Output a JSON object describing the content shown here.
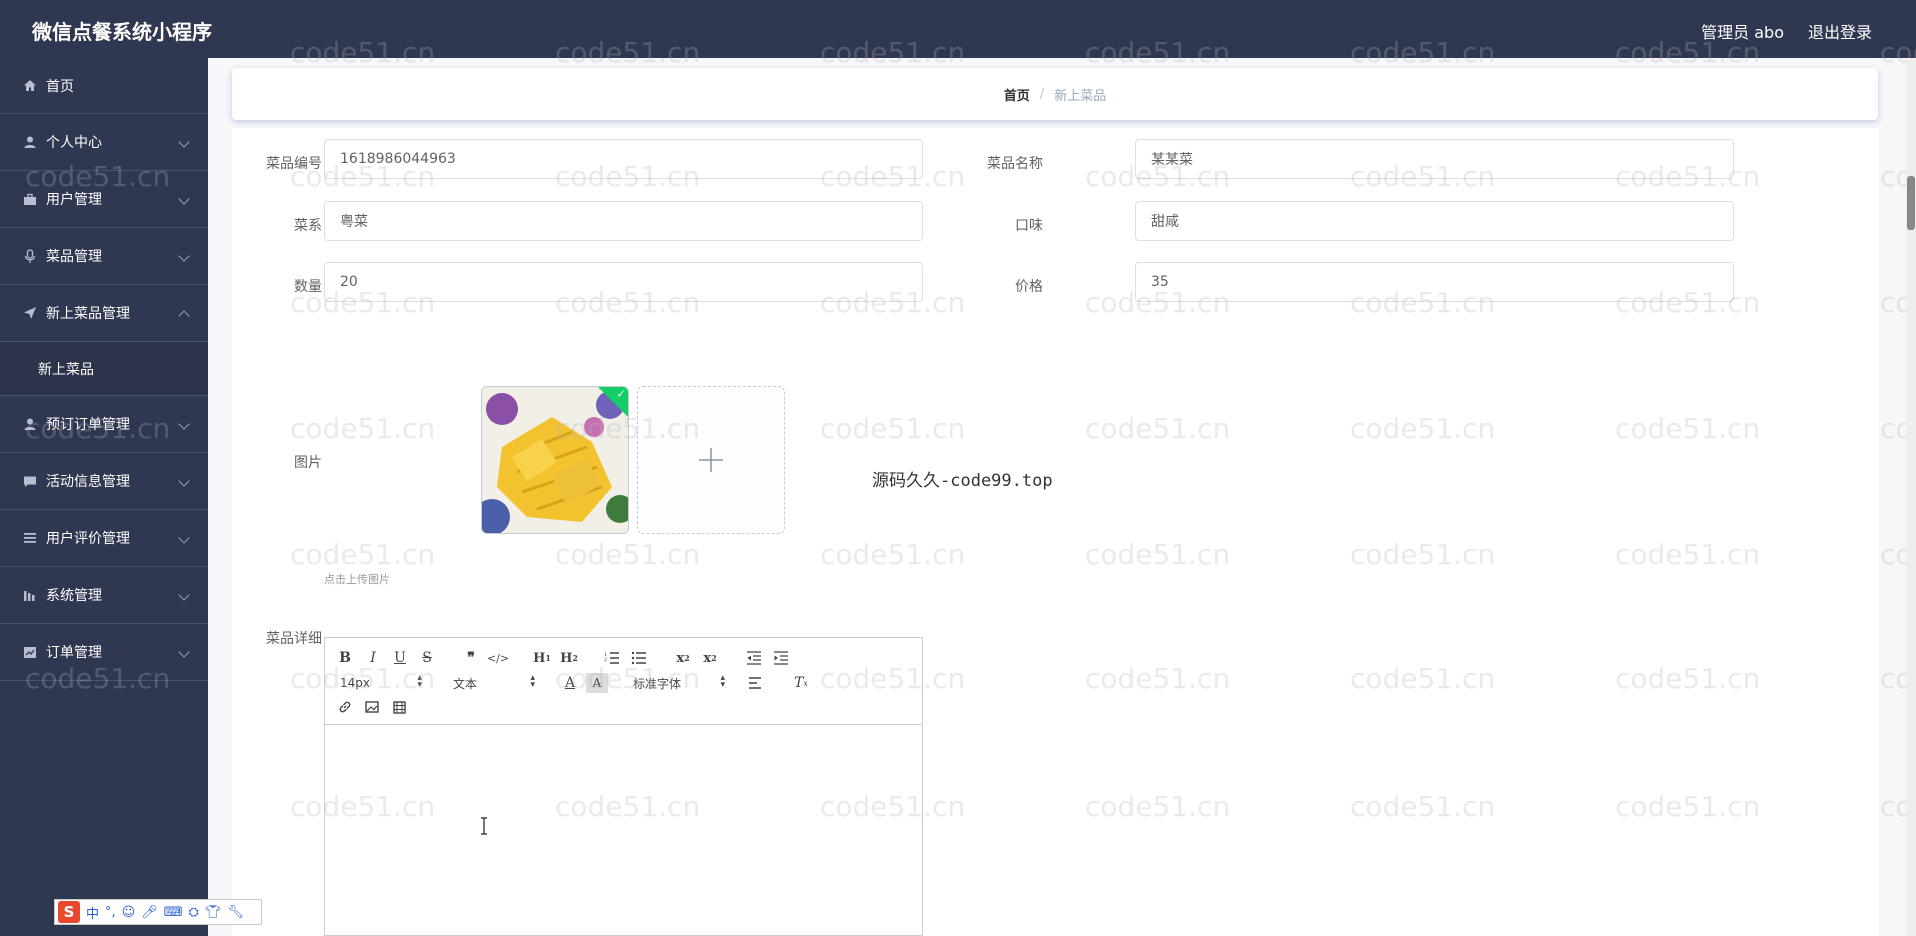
{
  "app": {
    "title": "微信点餐系统小程序",
    "user": "管理员 abo",
    "logout": "退出登录"
  },
  "sidebar": {
    "items": [
      {
        "label": "首页",
        "icon": "home-icon"
      },
      {
        "label": "个人中心",
        "icon": "user-icon"
      },
      {
        "label": "用户管理",
        "icon": "briefcase-icon"
      },
      {
        "label": "菜品管理",
        "icon": "mic-icon"
      },
      {
        "label": "新上菜品管理",
        "icon": "send-icon"
      },
      {
        "label": "预订订单管理",
        "icon": "user-icon"
      },
      {
        "label": "活动信息管理",
        "icon": "message-icon"
      },
      {
        "label": "用户评价管理",
        "icon": "menu-icon"
      },
      {
        "label": "系统管理",
        "icon": "bar-chart-icon"
      },
      {
        "label": "订单管理",
        "icon": "chart-box-icon"
      }
    ],
    "submenu": {
      "label": "新上菜品"
    }
  },
  "breadcrumb": {
    "home": "首页",
    "separator": "/",
    "current": "新上菜品"
  },
  "form": {
    "code_label": "菜品编号",
    "code_value": "1618986044963",
    "name_label": "菜品名称",
    "name_value": "某某菜",
    "cuisine_label": "菜系",
    "cuisine_value": "粤菜",
    "taste_label": "口味",
    "taste_value": "甜咸",
    "quantity_label": "数量",
    "quantity_value": "20",
    "price_label": "价格",
    "price_value": "35",
    "image_label": "图片",
    "upload_hint": "点击上传图片",
    "detail_label": "菜品详细"
  },
  "editor": {
    "font_size": "14px",
    "text_type": "文本",
    "font_family": "标准字体"
  },
  "overlay": {
    "site": "源码久久-code99.top",
    "watermark": "code51.cn"
  },
  "ime": {
    "lang": "中"
  },
  "colors": {
    "sidebar_bg": "#303750",
    "success": "#13ce66"
  }
}
